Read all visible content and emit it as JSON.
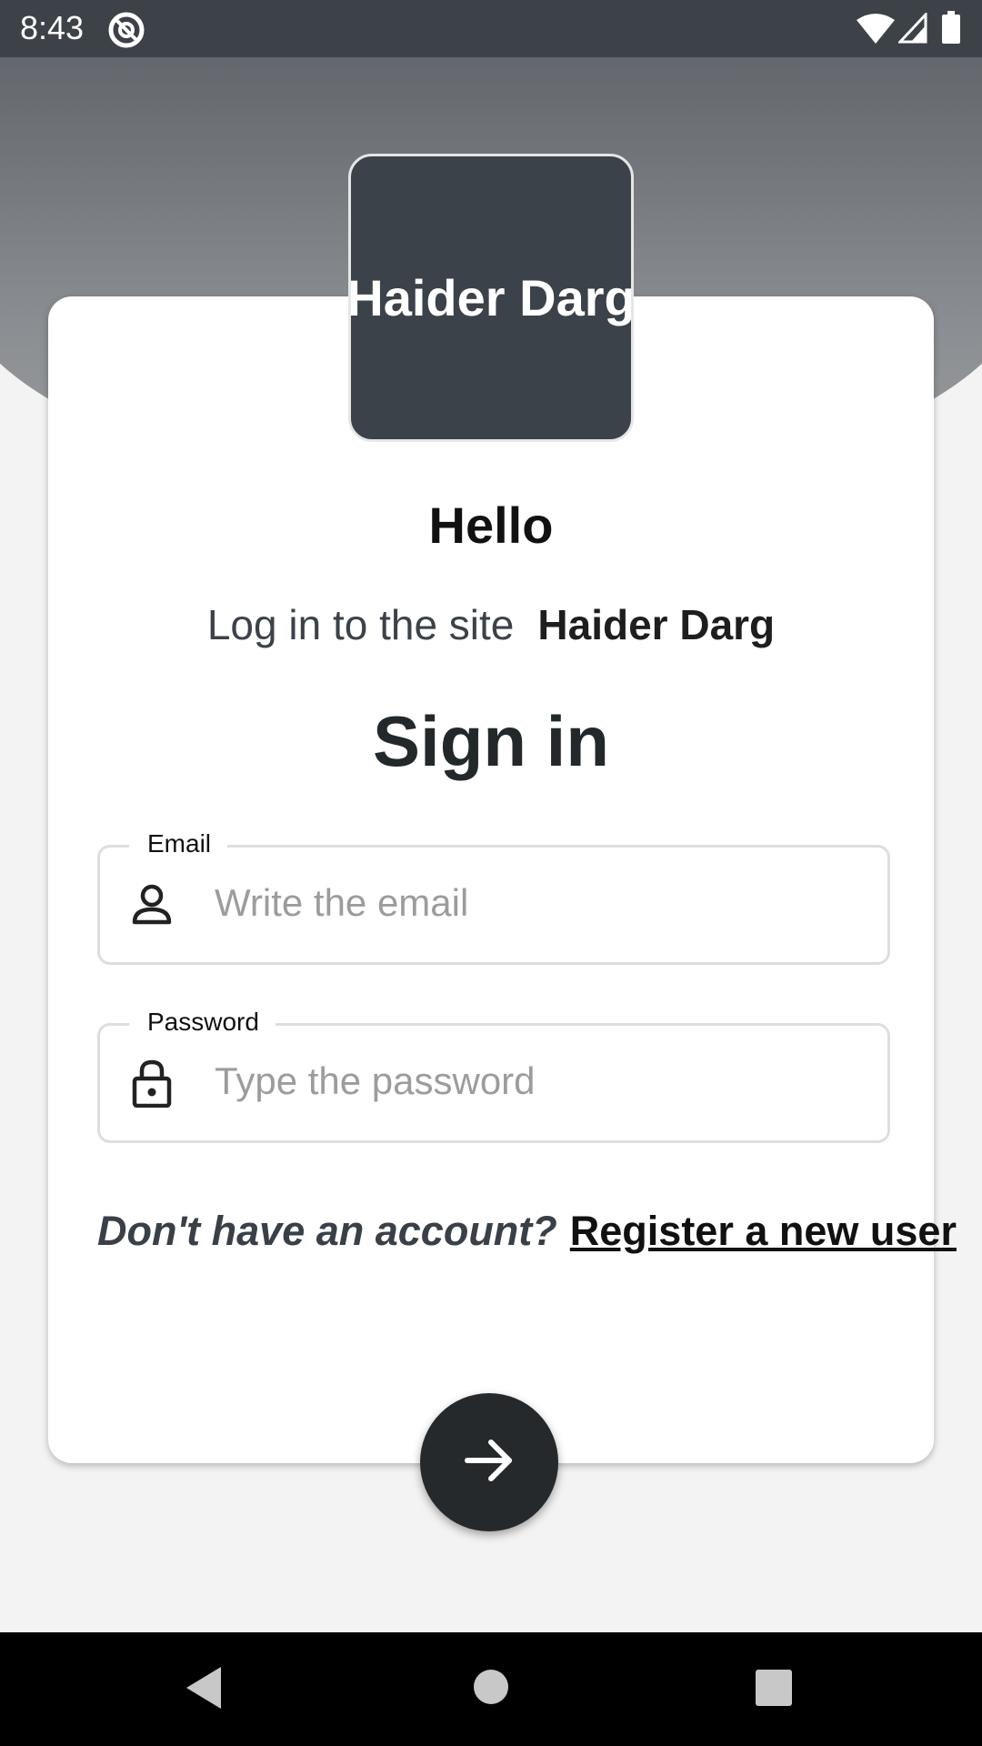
{
  "status_bar": {
    "time": "8:43",
    "icons": [
      "at-sign-icon",
      "wifi-icon",
      "signal-icon",
      "battery-icon"
    ]
  },
  "logo": {
    "text": "Haider Darg"
  },
  "greeting": "Hello",
  "subtitle": {
    "prefix": "Log in to the site",
    "site_name": "Haider Darg"
  },
  "heading": "Sign in",
  "form": {
    "email": {
      "label": "Email",
      "placeholder": "Write the email",
      "value": "",
      "icon": "person-icon"
    },
    "password": {
      "label": "Password",
      "placeholder": "Type the password",
      "value": "",
      "icon": "lock-icon"
    }
  },
  "register": {
    "question": "Don't have an account?",
    "link": "Register a new user"
  },
  "submit": {
    "icon": "arrow-right-icon"
  },
  "nav": {
    "icons": [
      "back-icon",
      "home-icon",
      "recents-icon"
    ]
  },
  "colors": {
    "status_bar": "#3c4247",
    "card": "#ffffff",
    "logo_bg": "#3c4249",
    "submit_bg": "#25292b",
    "background": "#f3f3f3"
  }
}
